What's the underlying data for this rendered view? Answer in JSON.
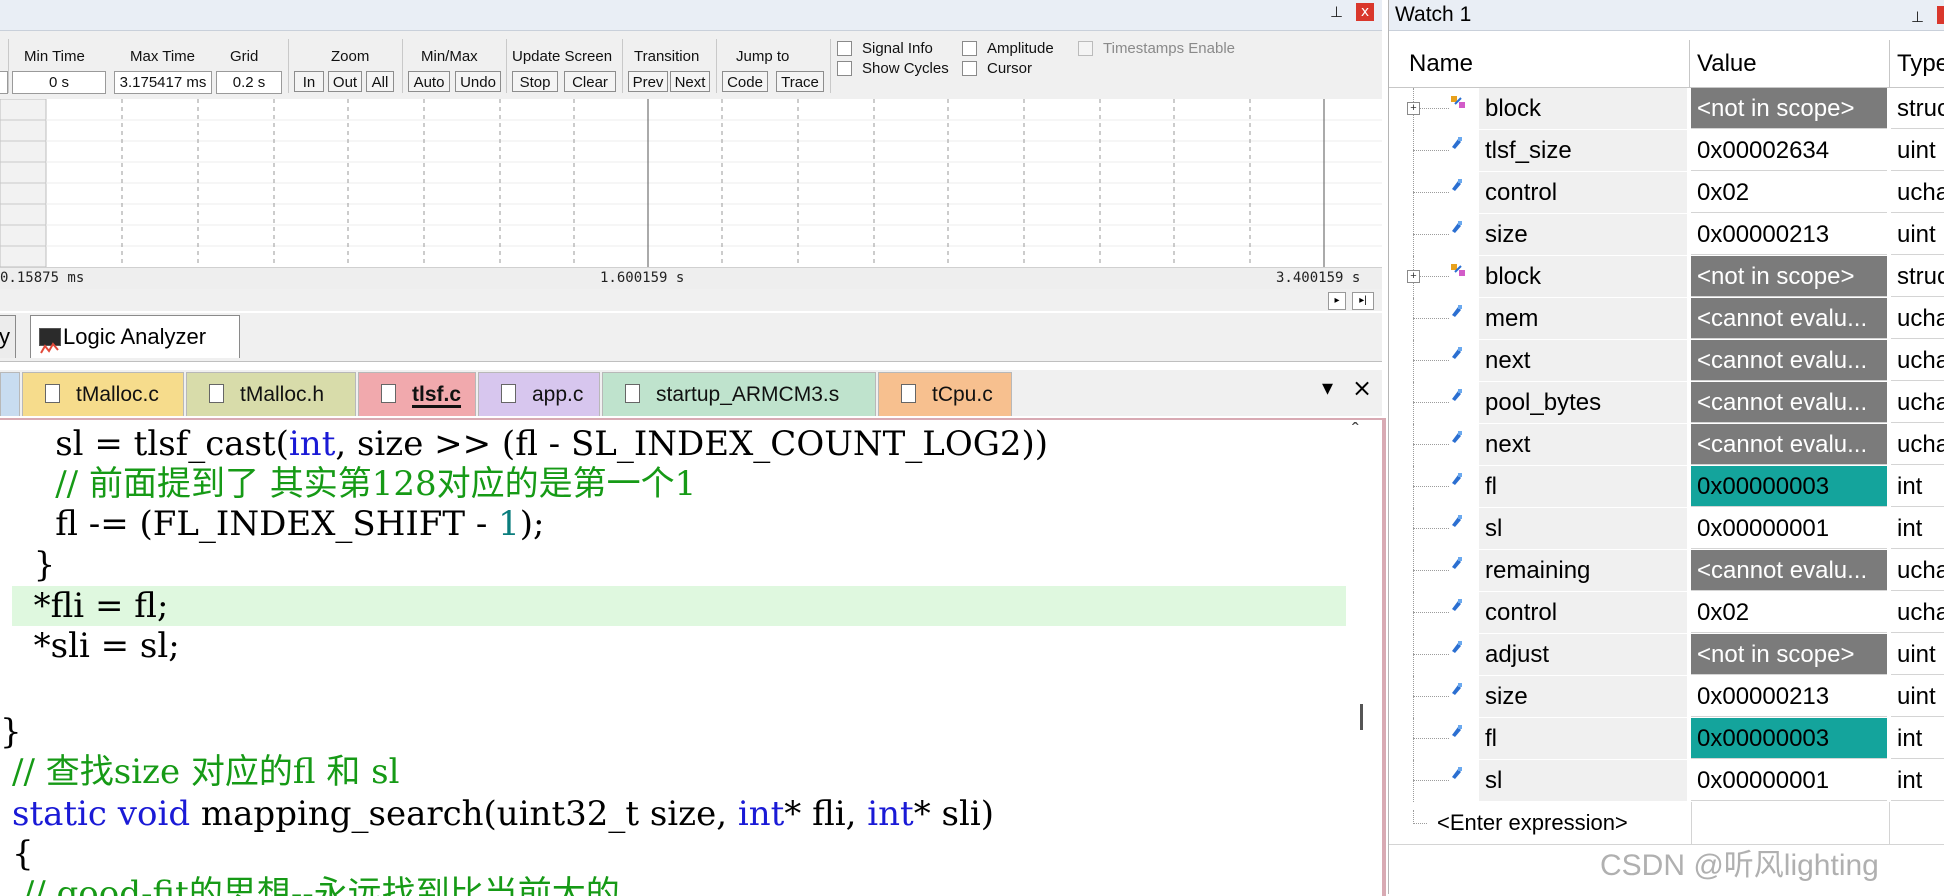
{
  "logic_analyzer": {
    "min_time_label": "Min Time",
    "min_time_value": "0 s",
    "max_time_label": "Max Time",
    "max_time_value": "3.175417 ms",
    "grid_label": "Grid",
    "grid_value": "0.2 s",
    "zoom_label": "Zoom",
    "zoom_in": "In",
    "zoom_out": "Out",
    "zoom_all": "All",
    "minmax_label": "Min/Max",
    "minmax_auto": "Auto",
    "minmax_undo": "Undo",
    "update_label": "Update Screen",
    "update_stop": "Stop",
    "update_clear": "Clear",
    "transition_label": "Transition",
    "transition_prev": "Prev",
    "transition_next": "Next",
    "jump_label": "Jump to",
    "jump_code": "Code",
    "jump_trace": "Trace",
    "signal_info": "Signal Info",
    "show_cycles": "Show Cycles",
    "amplitude": "Amplitude",
    "cursor": "Cursor",
    "timestamps": "Timestamps Enable",
    "time_left": "0.15875 ms",
    "time_mid": "1.600159 s",
    "time_right": "3.400159 s",
    "close_glyph": "x",
    "pin_glyph": "⊥"
  },
  "bottom_tabs": {
    "partial": "y",
    "logic_analyzer": "Logic Analyzer"
  },
  "file_tabs": [
    {
      "label": "tMalloc.c",
      "color": "#f6dc8c"
    },
    {
      "label": "tMalloc.h",
      "color": "#d8dcaa"
    },
    {
      "label": "tlsf.c",
      "color": "#f1a9ad"
    },
    {
      "label": "app.c",
      "color": "#d7c6ee"
    },
    {
      "label": "startup_ARMCM3.s",
      "color": "#bfe3cd"
    },
    {
      "label": "tCpu.c",
      "color": "#f7c08f"
    }
  ],
  "tab_controls": {
    "dropdown": "▾",
    "close": "×"
  },
  "code": {
    "l1a": "    sl = tlsf_cast(",
    "l1b": "int",
    "l1c": ", size >> (fl - SL_INDEX_COUNT_LOG2))",
    "l2": "    // 前面提到了 其实第128对应的是第一个1",
    "l3a": "    fl -= (FL_INDEX_SHIFT - ",
    "l3b": "1",
    "l3c": ");",
    "l4": "  }",
    "l5": "  *fli = fl;",
    "l6": "  *sli = sl;",
    "l7": "}",
    "l8": "// 查找size 对应的fl 和 sl",
    "l9a": "static",
    "l9b": "void",
    "l9c": " mapping_search(uint32_t size, ",
    "l9d": "int",
    "l9e": "* fli, ",
    "l9f": "int",
    "l9g": "* sli)",
    "l10": "{",
    "l11": " // good-fit的思想--永远找到比当前大的"
  },
  "watch": {
    "title": "Watch 1",
    "col_name": "Name",
    "col_value": "Value",
    "col_type": "Type",
    "rows": [
      {
        "name": "block",
        "value": "<not in scope>",
        "type": "struct",
        "style": "grey",
        "expand": true
      },
      {
        "name": "tlsf_size",
        "value": "0x00002634",
        "type": "uint",
        "style": "plain",
        "expand": false
      },
      {
        "name": "control",
        "value": "0x02",
        "type": "uchar",
        "style": "plain",
        "expand": false
      },
      {
        "name": "size",
        "value": "0x00000213",
        "type": "uint",
        "style": "plain",
        "expand": false
      },
      {
        "name": "block",
        "value": "<not in scope>",
        "type": "struct",
        "style": "grey",
        "expand": true
      },
      {
        "name": "mem",
        "value": "<cannot evalu...",
        "type": "uchar",
        "style": "grey",
        "expand": false
      },
      {
        "name": "next",
        "value": "<cannot evalu...",
        "type": "uchar",
        "style": "grey",
        "expand": false
      },
      {
        "name": "pool_bytes",
        "value": "<cannot evalu...",
        "type": "uchar",
        "style": "grey",
        "expand": false
      },
      {
        "name": "next",
        "value": "<cannot evalu...",
        "type": "uchar",
        "style": "grey",
        "expand": false
      },
      {
        "name": "fl",
        "value": "0x00000003",
        "type": "int",
        "style": "teal",
        "expand": false
      },
      {
        "name": "sl",
        "value": "0x00000001",
        "type": "int",
        "style": "plain",
        "expand": false
      },
      {
        "name": "remaining",
        "value": "<cannot evalu...",
        "type": "uchar",
        "style": "grey",
        "expand": false
      },
      {
        "name": "control",
        "value": "0x02",
        "type": "uchar",
        "style": "plain",
        "expand": false
      },
      {
        "name": "adjust",
        "value": "<not in scope>",
        "type": "uint",
        "style": "grey",
        "expand": false
      },
      {
        "name": "size",
        "value": "0x00000213",
        "type": "uint",
        "style": "plain",
        "expand": false
      },
      {
        "name": "fl",
        "value": "0x00000003",
        "type": "int",
        "style": "teal",
        "expand": false
      },
      {
        "name": "sl",
        "value": "0x00000001",
        "type": "int",
        "style": "plain",
        "expand": false
      }
    ],
    "enter_expression": "<Enter expression>"
  },
  "watermark": "CSDN @听风lighting",
  "colors": {
    "teal": "#14a49c",
    "grey": "#7b7b7b",
    "highlight": "#dff8df",
    "comment": "#169a16",
    "keyword": "#1a1ad6"
  }
}
